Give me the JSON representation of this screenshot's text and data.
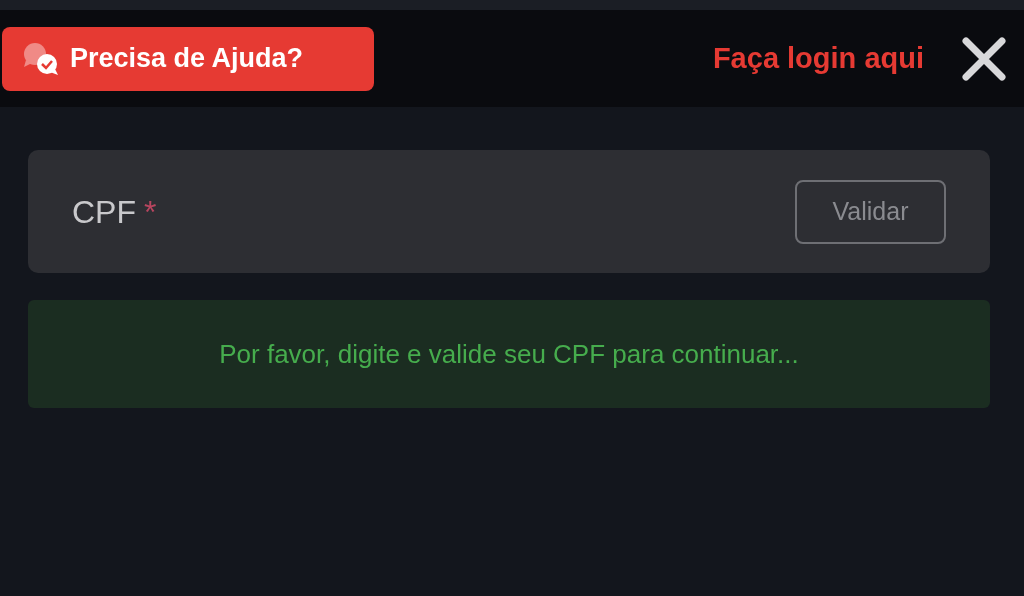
{
  "header": {
    "help_button": "Precisa de Ajuda?",
    "login_link": "Faça login aqui"
  },
  "cpf_field": {
    "label": "CPF",
    "required_mark": "*",
    "button": "Validar"
  },
  "alert": {
    "message": "Por favor, digite e valide seu CPF para continuar..."
  }
}
